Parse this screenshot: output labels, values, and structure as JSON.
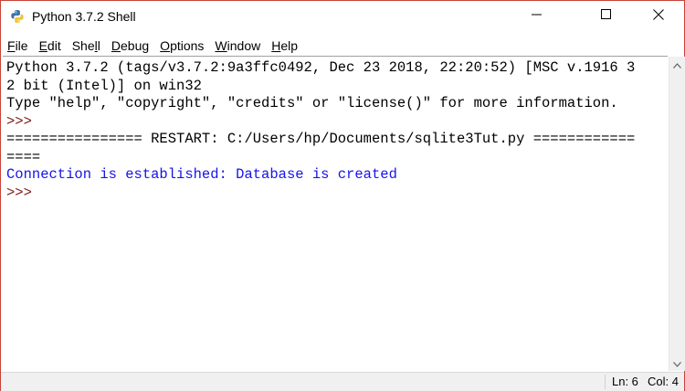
{
  "window": {
    "title": "Python 3.7.2 Shell",
    "app_icon": "python-icon"
  },
  "controls": {
    "minimize_icon": "minimize-icon",
    "maximize_icon": "maximize-icon",
    "close_icon": "close-icon"
  },
  "menu": [
    {
      "accel": "F",
      "rest": "ile"
    },
    {
      "accel": "E",
      "rest": "dit"
    },
    {
      "pre": "She",
      "accel": "l",
      "rest": "l"
    },
    {
      "accel": "D",
      "rest": "ebug"
    },
    {
      "accel": "O",
      "rest": "ptions"
    },
    {
      "accel": "W",
      "rest": "indow"
    },
    {
      "accel": "H",
      "rest": "elp"
    }
  ],
  "shell": {
    "banner_line1": "Python 3.7.2 (tags/v3.7.2:9a3ffc0492, Dec 23 2018, 22:20:52) [MSC v.1916 3",
    "banner_line2": "2 bit (Intel)] on win32",
    "banner_line3": "Type \"help\", \"copyright\", \"credits\" or \"license()\" for more information.",
    "prompt1": ">>> ",
    "restart_line1": "================ RESTART: C:/Users/hp/Documents/sqlite3Tut.py ============",
    "restart_line2": "====",
    "output": "Connection is established: Database is created",
    "prompt2": ">>> "
  },
  "status": {
    "line": "Ln: 6",
    "col": "Col: 4"
  },
  "colors": {
    "window_border": "#c7423a",
    "prompt": "#7f1a1a",
    "stdout": "#1515e8"
  }
}
